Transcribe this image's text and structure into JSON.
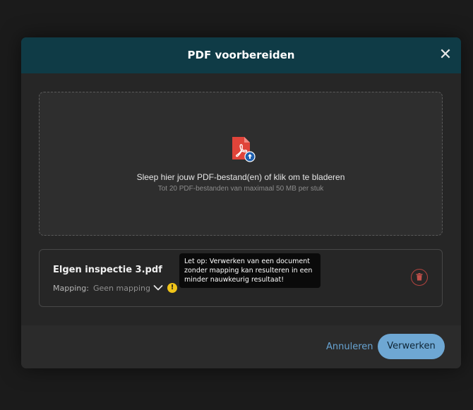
{
  "modal": {
    "title": "PDF voorbereiden",
    "close_icon": "close-icon"
  },
  "dropzone": {
    "icon": "pdf-upload-icon",
    "main_text": "Sleep hier jouw PDF-bestand(en) of klik om te bladeren",
    "sub_text": "Tot 20 PDF-bestanden van maximaal 50 MB per stuk"
  },
  "file": {
    "name": "Elgen inspectie 3.pdf",
    "mapping_label": "Mapping:",
    "mapping_value": "Geen mapping",
    "warning_icon_text": "!",
    "tooltip": "Let op: Verwerken van een document zonder mapping kan resulteren in een minder nauwkeurig resultaat!",
    "delete_icon": "trash-icon"
  },
  "footer": {
    "cancel_label": "Annuleren",
    "process_label": "Verwerken"
  },
  "colors": {
    "header_bg": "#0f3b46",
    "accent": "#6ea7d3",
    "danger": "#b4443f",
    "warning": "#f0c419",
    "pdf_red": "#e0443a"
  }
}
